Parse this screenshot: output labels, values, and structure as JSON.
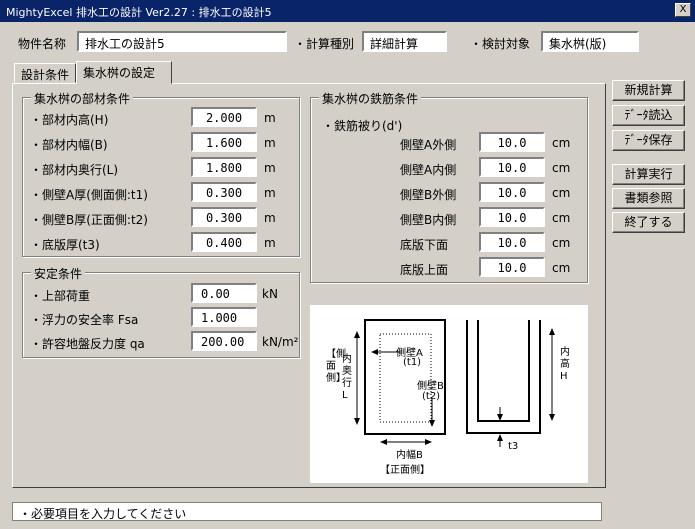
{
  "window": {
    "title": "MightyExcel 排水工の設計 Ver2.27 : 排水工の設計5",
    "close_label": "X"
  },
  "header": {
    "name_label": "物件名称",
    "name_value": "排水工の設計5",
    "calc_type_label": "・計算種別",
    "calc_type_value": "詳細計算",
    "target_label": "・検討対象",
    "target_value": "集水桝(版)"
  },
  "tabs": [
    {
      "label": "設計条件"
    },
    {
      "label": "集水桝の設定"
    }
  ],
  "member": {
    "title": "集水桝の部材条件",
    "rows": [
      {
        "label": "・部材内高(H)",
        "value": "2.000",
        "unit": "m"
      },
      {
        "label": "・部材内幅(B)",
        "value": "1.600",
        "unit": "m"
      },
      {
        "label": "・部材内奥行(L)",
        "value": "1.800",
        "unit": "m"
      },
      {
        "label": "・側壁A厚(側面側:t1)",
        "value": "0.300",
        "unit": "m"
      },
      {
        "label": "・側壁B厚(正面側:t2)",
        "value": "0.300",
        "unit": "m"
      },
      {
        "label": "・底版厚(t3)",
        "value": "0.400",
        "unit": "m"
      }
    ]
  },
  "stability": {
    "title": "安定条件",
    "rows": [
      {
        "label": "・上部荷重",
        "value": "0.00",
        "unit": "kN"
      },
      {
        "label": "・浮力の安全率 Fsa",
        "value": "1.000",
        "unit": ""
      },
      {
        "label": "・許容地盤反力度 qa",
        "value": "200.00",
        "unit": "kN/m²"
      }
    ]
  },
  "rebar": {
    "title": "集水桝の鉄筋条件",
    "cover_label": "・鉄筋被り(d')",
    "rows": [
      {
        "label": "側壁A外側",
        "value": "10.0",
        "unit": "cm"
      },
      {
        "label": "側壁A内側",
        "value": "10.0",
        "unit": "cm"
      },
      {
        "label": "側壁B外側",
        "value": "10.0",
        "unit": "cm"
      },
      {
        "label": "側壁B内側",
        "value": "10.0",
        "unit": "cm"
      },
      {
        "label": "底版下面",
        "value": "10.0",
        "unit": "cm"
      },
      {
        "label": "底版上面",
        "value": "10.0",
        "unit": "cm"
      }
    ]
  },
  "diagram": {
    "side_label": "【側面側】",
    "depth_label": "内奥行L",
    "wall_a_label": "側壁A",
    "wall_a_sub": "(t1)",
    "wall_b_label": "側壁B",
    "wall_b_sub": "(t2)",
    "width_label": "内幅B",
    "front_label": "【正面側】",
    "height_label": "内高H",
    "t3_label": "t3"
  },
  "buttons": {
    "new_calc": "新規計算",
    "load_data": "ﾃﾞｰﾀ読込",
    "save_data": "ﾃﾞｰﾀ保存",
    "run_calc": "計算実行",
    "view_docs": "書類参照",
    "exit": "終了する"
  },
  "status": {
    "message": "・必要項目を入力してください"
  }
}
